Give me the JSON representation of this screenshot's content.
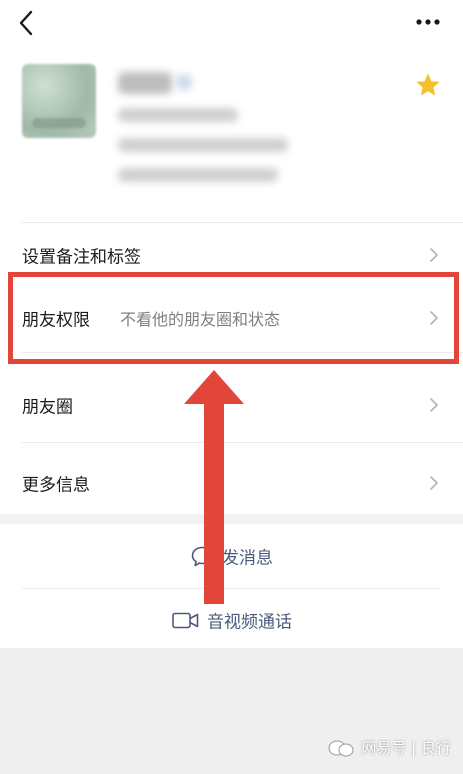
{
  "rows": [
    {
      "label": "设置备注和标签",
      "sub": ""
    },
    {
      "label": "朋友权限",
      "sub": "不看他的朋友圈和状态"
    },
    {
      "label": "朋友圈",
      "sub": ""
    },
    {
      "label": "更多信息",
      "sub": ""
    }
  ],
  "actions": {
    "message": "发消息",
    "call": "音视频通话"
  },
  "watermark": "网易号 | 良行",
  "colors": {
    "highlight": "#e2453a",
    "star": "#f5c02b",
    "action_text": "#4a5a7d"
  },
  "icons": {
    "back": "chevron-left-icon",
    "more": "more-dots-icon",
    "star": "star-icon",
    "chevron": "chevron-right-icon",
    "message": "chat-bubble-icon",
    "call": "video-camera-icon"
  }
}
